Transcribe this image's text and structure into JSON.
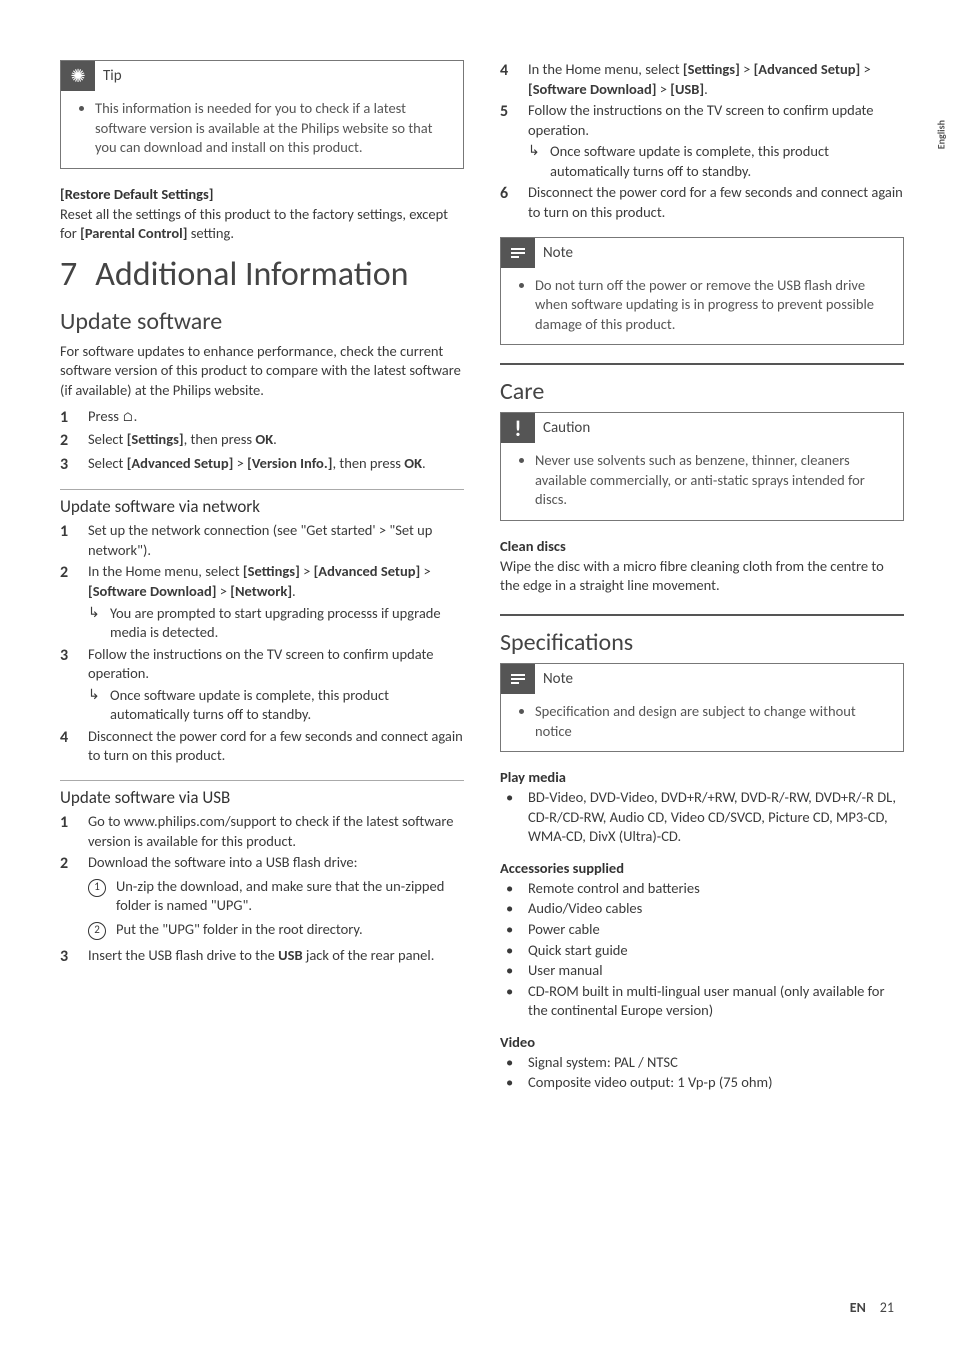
{
  "sideTab": "English",
  "left": {
    "tip": {
      "title": "Tip",
      "body": "This information is needed for you to check if a latest software version is available at the Philips website so that you can download and install on this product."
    },
    "restore": {
      "heading": "[Restore Default Settings]",
      "text_a": "Reset all the settings of this product to the factory settings, except for ",
      "text_b": "[Parental Control]",
      "text_c": " setting."
    },
    "chapter": {
      "num": "7",
      "title": "Additional Information"
    },
    "update": {
      "h2": "Update software",
      "intro": "For software updates to enhance performance, check the current software version of this product to compare with the latest software (if available) at the Philips website.",
      "steps": [
        {
          "n": "1",
          "parts": [
            "Press ",
            "⌂",
            "."
          ]
        },
        {
          "n": "2",
          "parts": [
            "Select ",
            "[Settings]",
            ", then press ",
            "OK",
            "."
          ]
        },
        {
          "n": "3",
          "parts": [
            "Select ",
            "[Advanced Setup]",
            " > ",
            "[Version Info.]",
            ", then press ",
            "OK",
            "."
          ]
        }
      ]
    },
    "network": {
      "h3": "Update software via network",
      "steps": [
        {
          "n": "1",
          "text": "Set up the network connection (see \"Get started' > \"Set up network\")."
        },
        {
          "n": "2",
          "prefix": "In the Home menu, select ",
          "b1": "[Settings]",
          "mid1": " > ",
          "b2": "[Advanced Setup]",
          "mid2": " > ",
          "b3": "[Software Download]",
          "mid3": " > ",
          "b4": "[Network]",
          "suffix": ".",
          "arrow": "You are prompted to start upgrading processs if upgrade media is detected."
        },
        {
          "n": "3",
          "text": "Follow the instructions on the TV screen to confirm update operation.",
          "arrow": "Once software update is complete, this product automatically turns off to standby."
        },
        {
          "n": "4",
          "text": "Disconnect the power cord for a few seconds and connect again to turn on this product."
        }
      ]
    },
    "usb": {
      "h3": "Update software via USB",
      "steps": [
        {
          "n": "1",
          "text": "Go to www.philips.com/support to check if the latest software version is available for this product."
        },
        {
          "n": "2",
          "text": "Download the software into a USB flash drive:",
          "sub": [
            "Un-zip the download, and make sure that the un-zipped folder is named \"UPG\".",
            "Put the \"UPG\" folder in the root directory."
          ]
        },
        {
          "n": "3",
          "pre": "Insert the USB flash drive to the ",
          "b": "USB",
          "post": " jack of the rear panel."
        }
      ]
    }
  },
  "right": {
    "contSteps": [
      {
        "n": "4",
        "prefix": "In the Home menu, select ",
        "b1": "[Settings]",
        "mid1": " > ",
        "b2": "[Advanced Setup]",
        "mid2": " > ",
        "b3": "[Software Download]",
        "mid3": " > ",
        "b4": "[USB]",
        "suffix": "."
      },
      {
        "n": "5",
        "text": "Follow the instructions on the TV screen to confirm update operation.",
        "arrow": "Once software update is complete, this product automatically turns off to standby."
      },
      {
        "n": "6",
        "text": "Disconnect the power cord for a few seconds and connect again to turn on this product."
      }
    ],
    "note1": {
      "title": "Note",
      "body": "Do not turn off the power or remove the USB flash drive when software updating is in progress to prevent possible damage of this product."
    },
    "care": {
      "h2": "Care",
      "caution": {
        "title": "Caution",
        "body": "Never use solvents such as benzene, thinner, cleaners available commercially, or anti-static sprays intended for discs."
      },
      "clean_h4": "Clean discs",
      "clean_p": "Wipe the disc with a micro fibre cleaning cloth from the centre to the edge in a straight line movement."
    },
    "spec": {
      "h2": "Specifications",
      "note": {
        "title": "Note",
        "body": "Specification and design are subject to change without notice"
      },
      "playmedia_h4": "Play media",
      "playmedia_item": "BD-Video, DVD-Video, DVD+R/+RW, DVD-R/-RW, DVD+R/-R DL, CD-R/CD-RW, Audio CD, Video CD/SVCD, Picture CD, MP3-CD, WMA-CD, DivX (Ultra)-CD.",
      "acc_h4": "Accessories supplied",
      "acc": [
        "Remote control and batteries",
        "Audio/Video cables",
        "Power cable",
        "Quick start guide",
        "User manual",
        "CD-ROM built in multi-lingual user manual (only available for the continental Europe version)"
      ],
      "video_h4": "Video",
      "video": [
        "Signal system: PAL / NTSC",
        "Composite video output: 1 Vp-p (75 ohm)"
      ]
    }
  },
  "footer": {
    "lang": "EN",
    "page": "21"
  }
}
